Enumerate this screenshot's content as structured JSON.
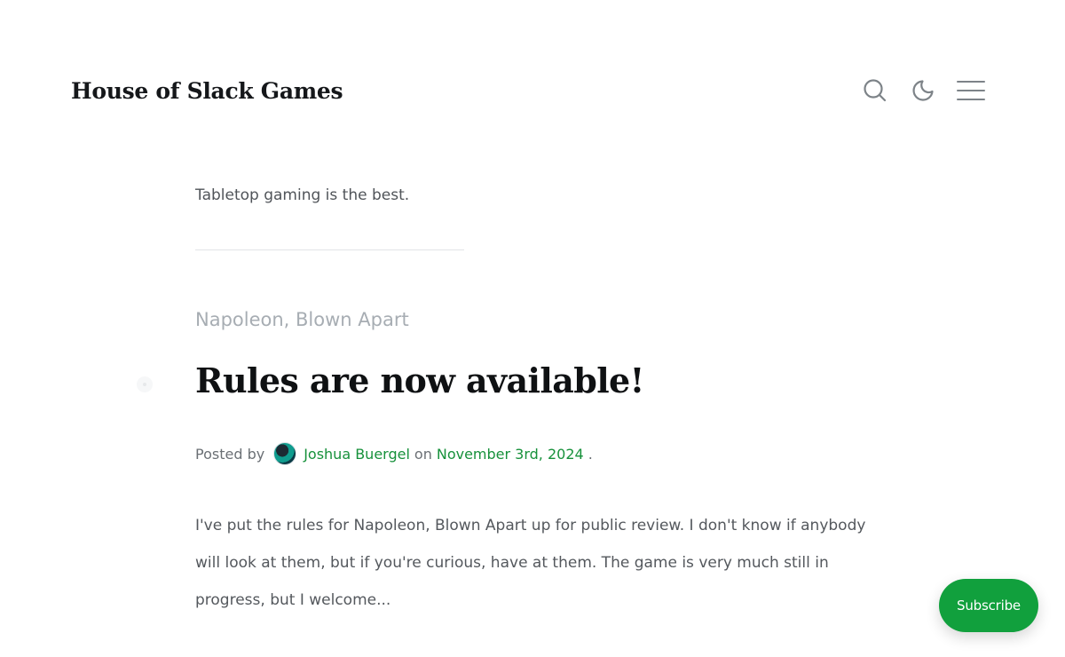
{
  "header": {
    "site_title": "House of Slack Games",
    "icons": [
      "search-icon",
      "moon-icon",
      "menu-icon"
    ]
  },
  "tagline": "Tabletop gaming is the best.",
  "post": {
    "tag": "Napoleon, Blown Apart",
    "title": "Rules are now available!",
    "meta": {
      "posted_by": "Posted by",
      "author": "Joshua Buergel",
      "on": "on",
      "date": "November 3rd, 2024",
      "end": "."
    },
    "excerpt": "I've put the rules for Napoleon, Blown Apart up for public review. I don't know if anybody will look at them, but if you're curious, have at them. The game is very much still in progress, but I welcome..."
  },
  "subscribe_label": "Subscribe",
  "colors": {
    "accent": "#17913b",
    "subscribe_bg": "#11a03d",
    "title": "#0f1113",
    "muted": "#a7adb3"
  }
}
